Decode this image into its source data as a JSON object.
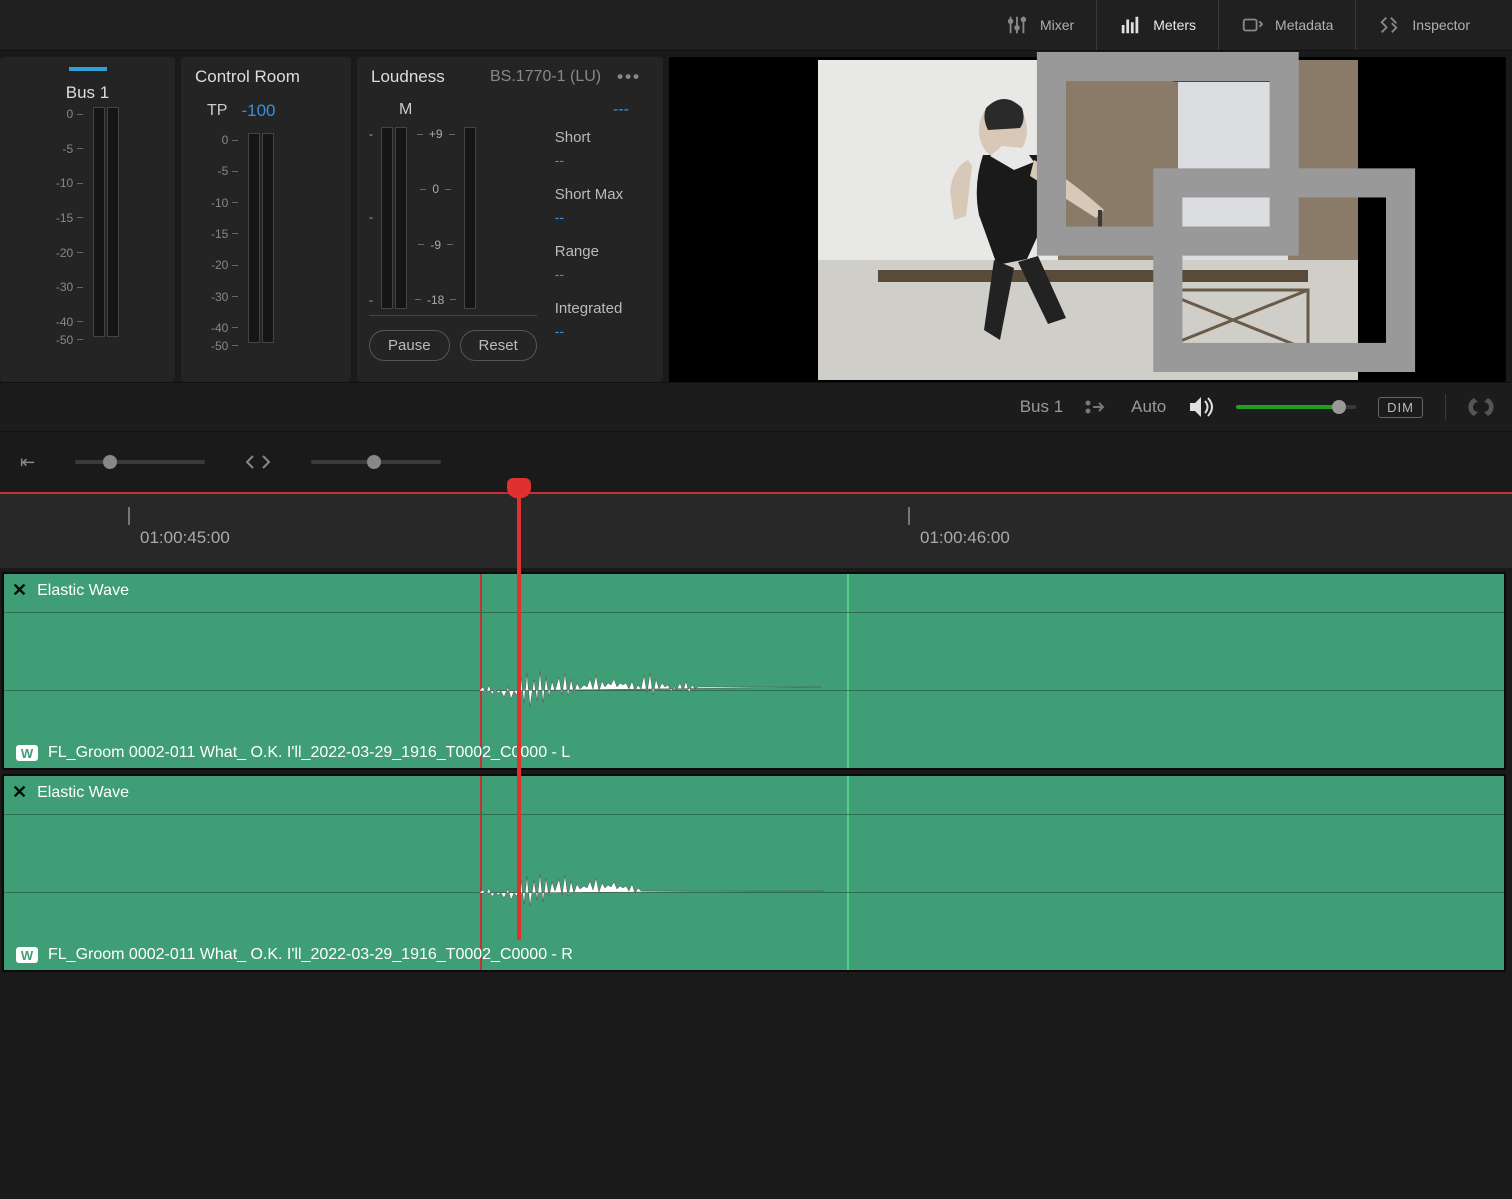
{
  "toolbar": {
    "mixer": "Mixer",
    "meters": "Meters",
    "metadata": "Metadata",
    "inspector": "Inspector"
  },
  "bus_panel": {
    "title": "Bus 1",
    "scale": [
      "0",
      "-5",
      "-10",
      "-15",
      "-20",
      "-30",
      "-40",
      "-50"
    ]
  },
  "control_room": {
    "title": "Control Room",
    "tp_label": "TP",
    "tp_value": "-100",
    "scale": [
      "0",
      "-5",
      "-10",
      "-15",
      "-20",
      "-30",
      "-40",
      "-50"
    ]
  },
  "loudness": {
    "title": "Loudness",
    "standard": "BS.1770-1 (LU)",
    "m_label": "M",
    "m_value": "---",
    "scale_left": [
      "-",
      "-",
      "-"
    ],
    "center_vals": [
      "+9",
      "0",
      "-9",
      "-18"
    ],
    "pause": "Pause",
    "reset": "Reset",
    "readouts": {
      "short": {
        "label": "Short",
        "value": "--"
      },
      "short_max": {
        "label": "Short Max",
        "value": "--"
      },
      "range": {
        "label": "Range",
        "value": "--"
      },
      "integrated": {
        "label": "Integrated",
        "value": "--"
      }
    }
  },
  "monitor": {
    "bus": "Bus 1",
    "auto": "Auto",
    "dim": "DIM"
  },
  "timeline": {
    "tc1": "01:00:45:00",
    "tc2": "01:00:46:00"
  },
  "clip": {
    "effect_name": "Elastic Wave",
    "name_l": "FL_Groom 0002-011 What_  O.K.  I'll_2022-03-29_1916_T0002_C0000 - L",
    "name_r": "FL_Groom 0002-011 What_  O.K.  I'll_2022-03-29_1916_T0002_C0000 - R"
  }
}
